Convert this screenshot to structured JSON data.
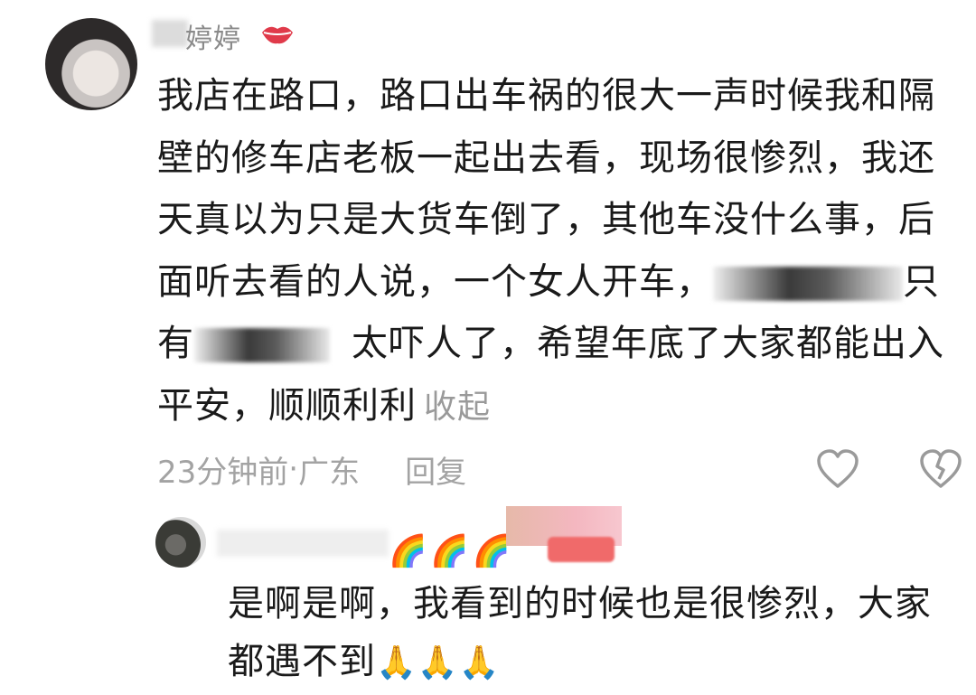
{
  "comment": {
    "username": "婷婷",
    "text_line1": "我店在路口，路口出车祸的很大一声时候我和隔",
    "text_line2": "壁的修车店老板一起出去看，现场很惨烈，我还",
    "text_line3": "天真以为只是大货车倒了，其他车没什么事，后",
    "text_line4_a": "面听去看的人说，一个女人开车，",
    "text_line4_b": "只",
    "text_line5_a": "有",
    "text_line5_b": "太吓人了，希望年底了大家都能出入",
    "text_line6": "平安，顺顺利利",
    "collapse_label": "收起",
    "time": "23分钟前",
    "separator": " · ",
    "location": "广东",
    "reply_label": "回复"
  },
  "reply": {
    "rainbow_emojis": "🌈🌈🌈",
    "text_line1": "是啊是啊，我看到的时候也是很惨烈，大家",
    "text_line2": "都遇不到",
    "pray_emojis": "🙏🙏🙏"
  },
  "colors": {
    "text": "#1a1a1a",
    "meta": "#a3a3a3",
    "lips": "#e03a4a",
    "badge": "#f06a6a"
  },
  "icons": {
    "like": "heart-outline-icon",
    "dislike": "broken-heart-outline-icon",
    "username_decoration": "lips-icon"
  }
}
